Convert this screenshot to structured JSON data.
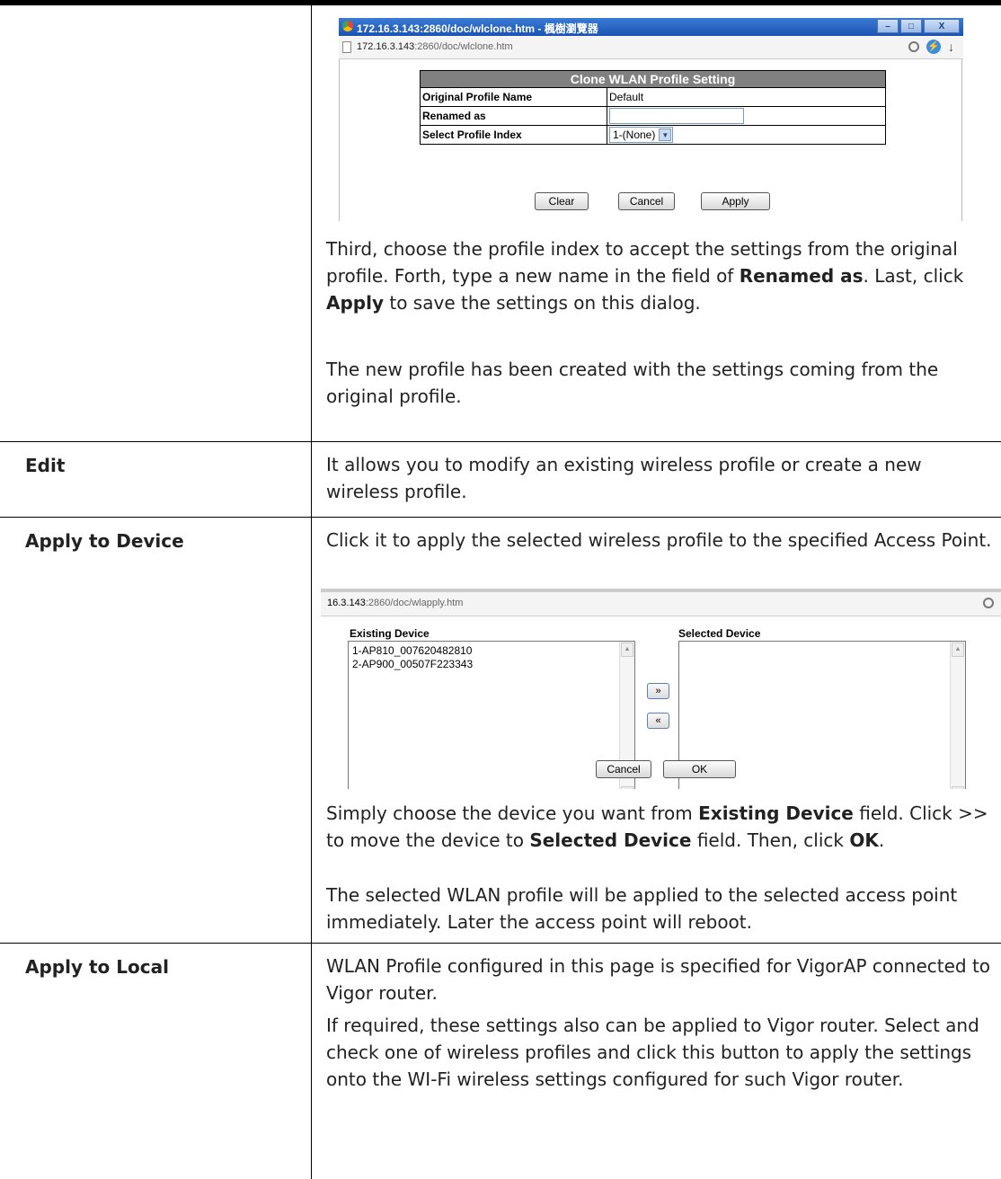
{
  "clone_dialog": {
    "window_title": "172.16.3.143:2860/doc/wlclone.htm - 楓樹瀏覽器",
    "window_buttons": [
      "–",
      "□",
      "X"
    ],
    "url_host": "172.16.3.143",
    "url_path": ":2860/doc/wlclone.htm",
    "table_title": "Clone WLAN Profile Setting",
    "rows": {
      "original_label": "Original Profile Name",
      "original_value": "Default",
      "renamed_label": "Renamed as",
      "renamed_value": "",
      "index_label": "Select Profile Index",
      "index_value": "1-(None)"
    },
    "buttons": {
      "clear": "Clear",
      "cancel": "Cancel",
      "apply": "Apply"
    }
  },
  "clone_text": {
    "p1_a": "Third, choose the profile index to accept the settings from the original profile. Forth, type a new name in the field of ",
    "p1_b": "Renamed as",
    "p1_c": ". Last, click ",
    "p1_d": "Apply",
    "p1_e": " to save the settings on this dialog.",
    "p2": "The new profile has been created with the settings coming from the original profile."
  },
  "rows": {
    "edit_label": "Edit",
    "edit_desc": "It allows you to modify an existing wireless profile or create a new wireless profile.",
    "apply_device_label": "Apply to Device",
    "apply_device_desc": "Click it to apply the selected wireless profile to the specified Access Point.",
    "apply_local_label": "Apply to Local",
    "apply_local_p1": "WLAN Profile configured in this page is specified for VigorAP connected to Vigor router.",
    "apply_local_p2": "If required, these settings also can be applied to Vigor router. Select and check one of wireless profiles and click this button to apply the settings onto the WI-Fi wireless settings configured for such Vigor router."
  },
  "apply_dialog": {
    "url_host": "16.3.143",
    "url_path": ":2860/doc/wlapply.htm",
    "existing_label": "Existing Device",
    "selected_label": "Selected Device",
    "existing_items": [
      "1-AP810_007620482810",
      "2-AP900_00507F223343"
    ],
    "move_right": "»",
    "move_left": "«",
    "cancel": "Cancel",
    "ok": "OK"
  },
  "apply_text": {
    "p1_a": "Simply choose the device you want from ",
    "p1_b": "Existing Device",
    "p1_c": " field. Click >> to move the device to ",
    "p1_d": "Selected Device",
    "p1_e": " field. Then, click ",
    "p1_f": "OK",
    "p1_g": ".",
    "p2": "The selected WLAN profile will be applied to the selected access point immediately. Later the access point will reboot."
  }
}
